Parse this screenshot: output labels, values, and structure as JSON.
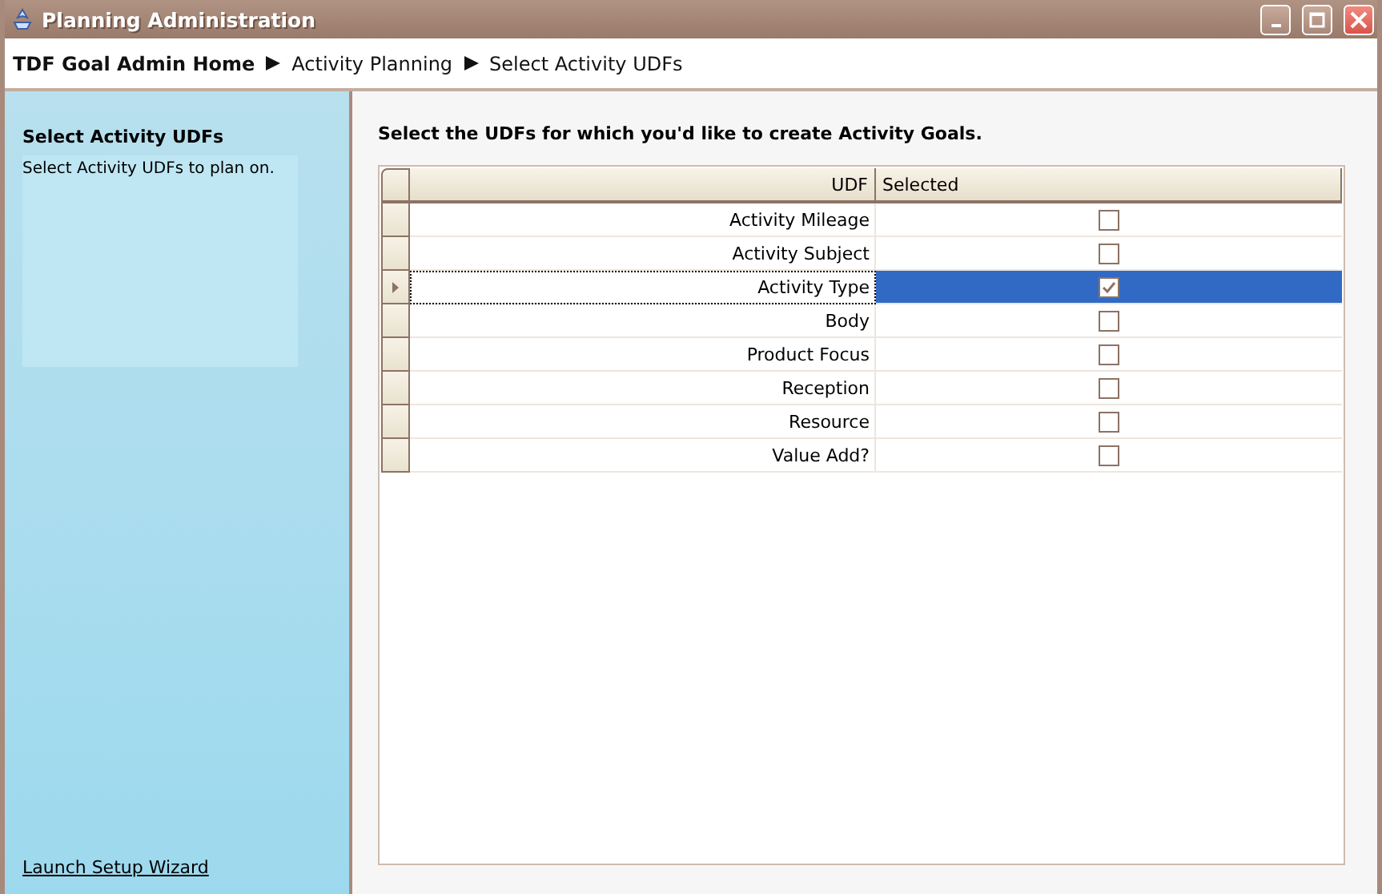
{
  "window": {
    "title": "Planning Administration"
  },
  "breadcrumb": [
    {
      "label": "TDF Goal Admin Home"
    },
    {
      "label": "Activity Planning"
    },
    {
      "label": "Select Activity UDFs"
    }
  ],
  "sidebar": {
    "title": "Select Activity UDFs",
    "description": "Select Activity UDFs to plan on.",
    "link": "Launch Setup Wizard"
  },
  "main": {
    "heading": "Select the UDFs for which you'd like to create Activity Goals."
  },
  "table": {
    "columns": [
      "UDF",
      "Selected"
    ],
    "rows": [
      {
        "udf": "Activity Mileage",
        "checked": false,
        "selected": false
      },
      {
        "udf": "Activity Subject",
        "checked": false,
        "selected": false
      },
      {
        "udf": "Activity Type",
        "checked": true,
        "selected": true
      },
      {
        "udf": "Body",
        "checked": false,
        "selected": false
      },
      {
        "udf": "Product Focus",
        "checked": false,
        "selected": false
      },
      {
        "udf": "Reception",
        "checked": false,
        "selected": false
      },
      {
        "udf": "Resource",
        "checked": false,
        "selected": false
      },
      {
        "udf": "Value Add?",
        "checked": false,
        "selected": false
      }
    ]
  }
}
